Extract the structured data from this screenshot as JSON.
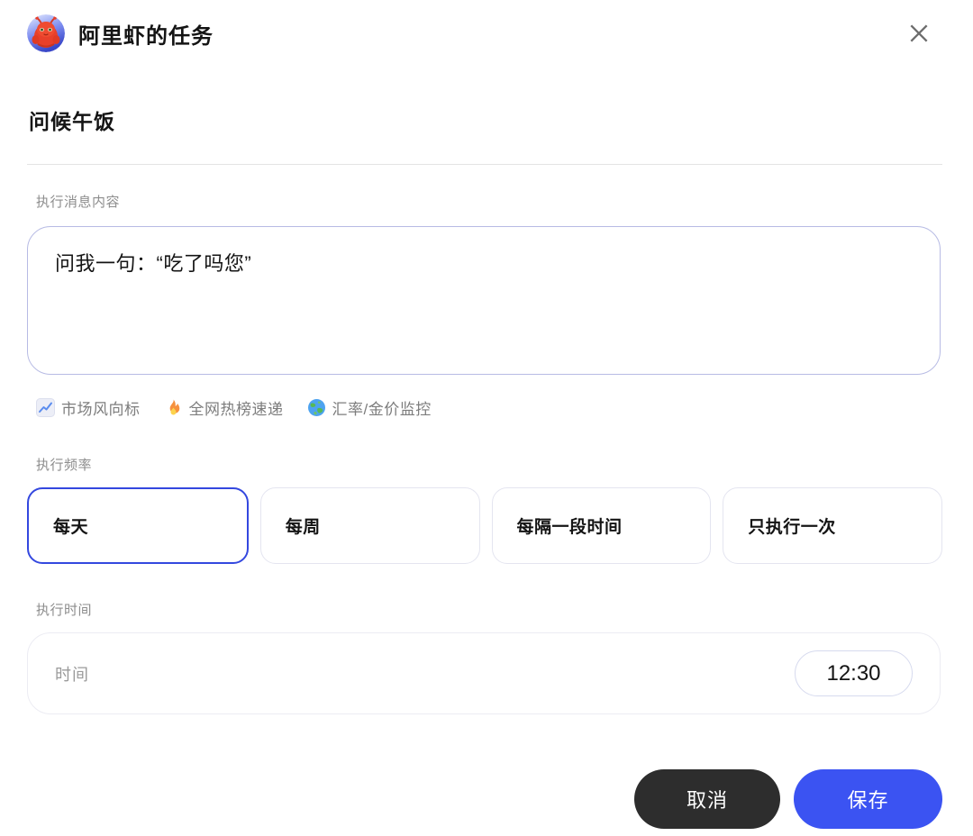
{
  "header": {
    "title": "阿里虾的任务",
    "avatar": "shrimp-mascot",
    "close": "×"
  },
  "task": {
    "name": "问候午饭"
  },
  "message": {
    "label": "执行消息内容",
    "value": "问我一句：“吃了吗您”"
  },
  "suggestions": [
    {
      "icon": "chart-icon",
      "label": "市场风向标"
    },
    {
      "icon": "fire-icon",
      "label": "全网热榜速递"
    },
    {
      "icon": "globe-icon",
      "label": "汇率/金价监控"
    }
  ],
  "frequency": {
    "label": "执行频率",
    "options": [
      {
        "label": "每天",
        "selected": true
      },
      {
        "label": "每周",
        "selected": false
      },
      {
        "label": "每隔一段时间",
        "selected": false
      },
      {
        "label": "只执行一次",
        "selected": false
      }
    ]
  },
  "time": {
    "label": "执行时间",
    "field_label": "时间",
    "value": "12:30"
  },
  "footer": {
    "cancel_label": "取消",
    "save_label": "保存"
  },
  "colors": {
    "accent_blue": "#3b53f2",
    "selected_border": "#3448df",
    "textarea_border": "#b7bbe4",
    "cancel_dark": "#2d2d2d",
    "label_gray": "#8d8d8d"
  }
}
